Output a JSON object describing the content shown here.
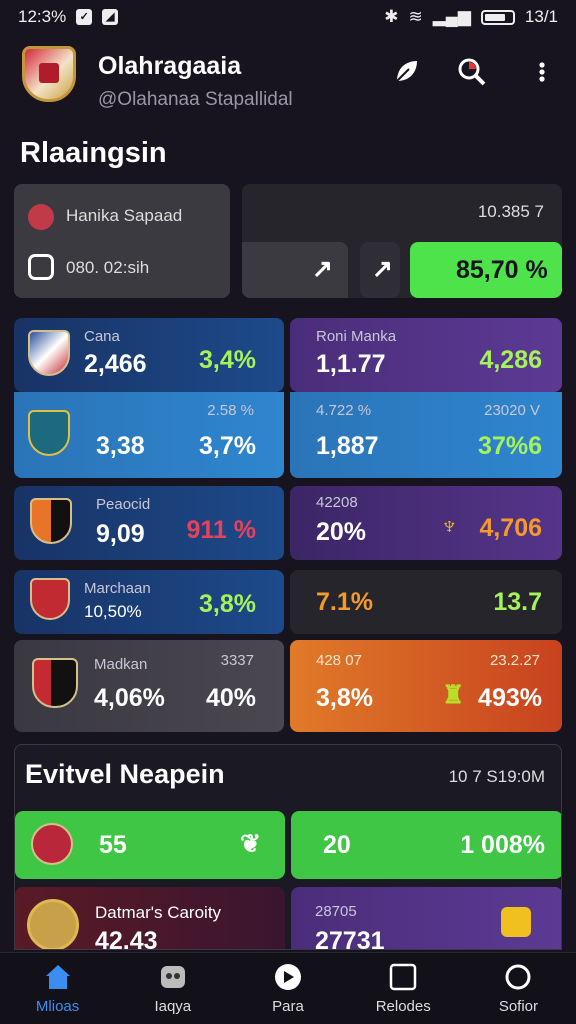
{
  "status_bar": {
    "time": "12:3%",
    "right_text": "13/1"
  },
  "header": {
    "title": "Olahragaaia",
    "handle": "@Olahanaa Stapallidal"
  },
  "section1": {
    "title": "Rlaaingsin",
    "top_left": {
      "row1_label": "Hanika Sapaad",
      "row2_label": "080. 02:sih"
    },
    "top_right": {
      "value": "10.385 7",
      "arrow1": "↗",
      "arrow2": "↗",
      "badge": "85,70 %"
    }
  },
  "cards": [
    {
      "label": "Cana",
      "value": "2,466",
      "pct": "3,4%"
    },
    {
      "label": "Roni Manka",
      "value": "1,1.77",
      "pct": "4,286"
    },
    {
      "label": "2.58 %",
      "value": "3,38",
      "pct": "3,7%"
    },
    {
      "label": "4.722 %",
      "value": "1,887",
      "pct": "37%6",
      "aux": "23020 V"
    },
    {
      "label": "Peaocid",
      "value": "9,09",
      "pct": "911 %"
    },
    {
      "label": "42208",
      "value": "20%",
      "pct": "4,706"
    },
    {
      "label": "Marchaan",
      "value": "10,50%",
      "pct": "3,8%"
    },
    {
      "label": "7.1%",
      "value": "13.7"
    },
    {
      "label": "Madkan",
      "value": "4,06%",
      "pct": "40%",
      "aux": "3337"
    },
    {
      "label": "428 07",
      "value": "3,8%",
      "pct": "493%",
      "aux": "23.2.27"
    }
  ],
  "section2": {
    "title": "Evitvel Neapein",
    "time": "10 7 S19:0M",
    "green_left": "55",
    "green_right_a": "20",
    "green_right_b": "1 008%",
    "bottom_left_label": "Datmar's Caroity",
    "bottom_left_value": "42.43",
    "bottom_right_label": "28705",
    "bottom_right_value": "27731"
  },
  "nav": [
    {
      "label": "Mlioas",
      "icon": "home-icon"
    },
    {
      "label": "Iaqya",
      "icon": "gamepad-icon"
    },
    {
      "label": "Para",
      "icon": "play-circle-icon"
    },
    {
      "label": "Relodes",
      "icon": "square-icon"
    },
    {
      "label": "Sofior",
      "icon": "circle-icon"
    }
  ],
  "colors": {
    "accent": "#3b8ef0",
    "green": "#3ec644",
    "bg": "#17141f"
  }
}
